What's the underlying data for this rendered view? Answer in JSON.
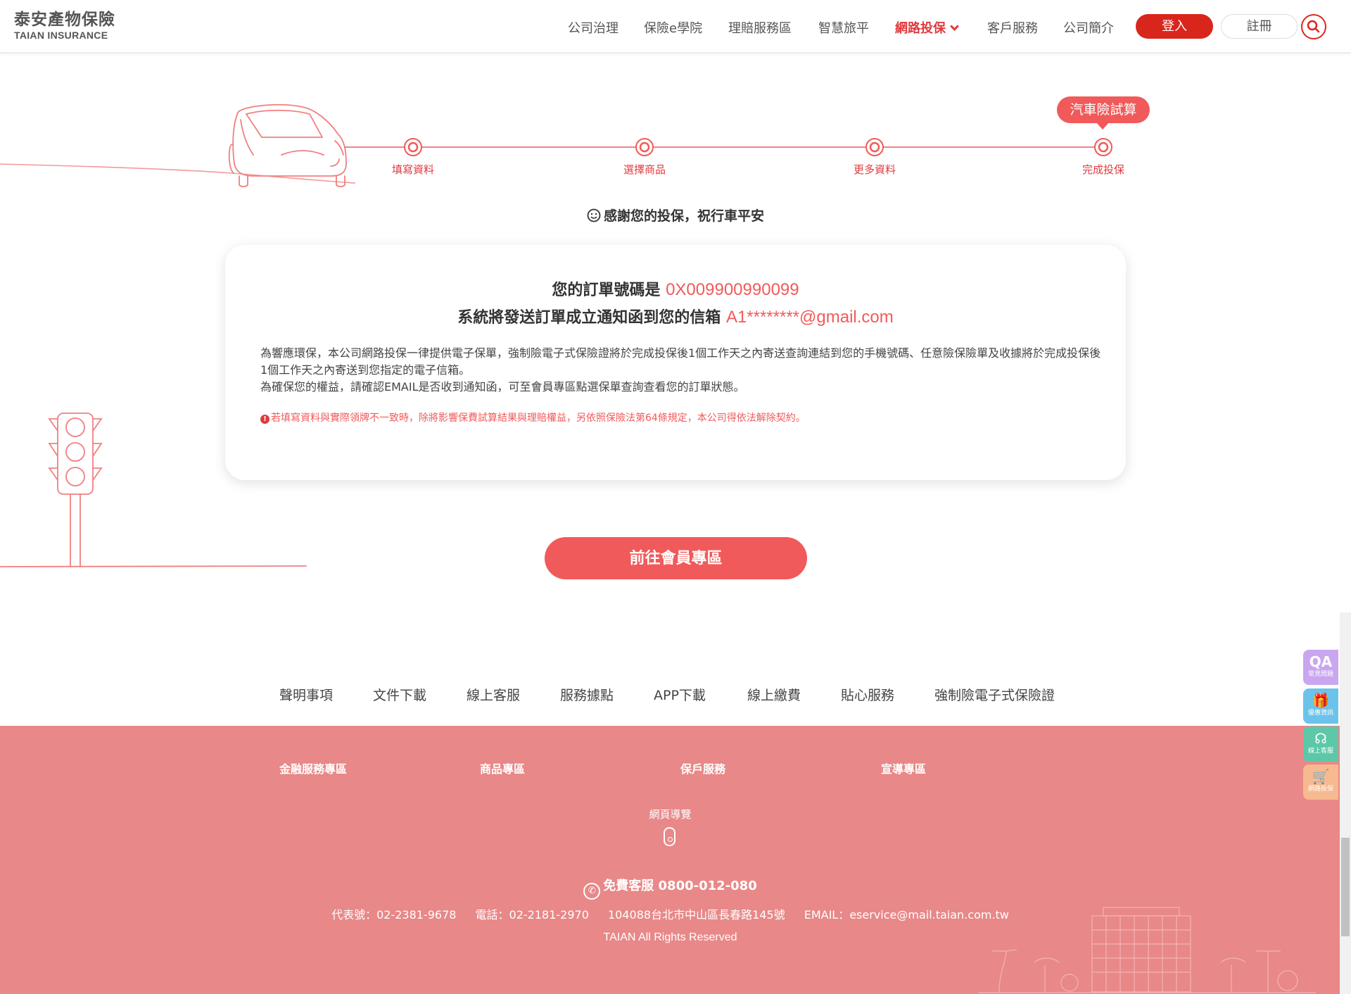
{
  "header": {
    "logo_cn": "泰安產物保險",
    "logo_en": "TAIAN INSURANCE",
    "nav": [
      {
        "label": "公司治理"
      },
      {
        "label": "保險e學院"
      },
      {
        "label": "理賠服務區"
      },
      {
        "label": "智慧旅平"
      },
      {
        "label": "網路投保"
      },
      {
        "label": "客戶服務"
      },
      {
        "label": "公司簡介"
      }
    ],
    "login_label": "登入",
    "register_label": "註冊",
    "accent_color": "#d9261c"
  },
  "steps": {
    "tag": "汽車險試算",
    "items": [
      "填寫資料",
      "選擇商品",
      "更多資料",
      "完成投保"
    ],
    "current": 4
  },
  "thanks": "感謝您的投保，祝行車平安",
  "card": {
    "order_prefix": "您的訂單號碼是",
    "order_number": "0X009900990099",
    "email_prefix": "系統將發送訂單成立通知函到您的信箱",
    "email": "A1********@gmail.com",
    "para1": "為響應環保，本公司網路投保一律提供電子保單，強制險電子式保險證將於完成投保後1個工作天之內寄送查詢連結到您的手機號碼、任意險保險單及收據將於完成投保後1個工作天之內寄送到您指定的電子信箱。",
    "para2": "為確保您的權益，請確認EMAIL是否收到通知函，可至會員專區點選保單查詢查看您的訂單狀態。",
    "warning": "若填寫資料與實際領牌不一致時，除將影響保費試算結果與理賠權益，另依照保險法第64條規定，本公司得依法解除契約。"
  },
  "member_button": "前往會員專區",
  "footer_links": [
    "聲明事項",
    "文件下載",
    "線上客服",
    "服務據點",
    "APP下載",
    "線上繳費",
    "貼心服務",
    "強制險電子式保險證"
  ],
  "footer": {
    "columns": [
      "金融服務專區",
      "商品專區",
      "保戶服務",
      "宣導專區"
    ],
    "sitemap": "網頁導覽",
    "hotline": "免費客服 0800-012-080",
    "contact": [
      "代表號：02-2381-9678",
      "電話：02-2181-2970",
      "104088台北市中山區長春路145號",
      "EMAIL：eservice@mail.taian.com.tw"
    ],
    "rights": "TAIAN All Rights Reserved",
    "bg_color": "#e88888"
  },
  "side_widgets": [
    {
      "icon": "QA",
      "label": "常見問題",
      "color": "#c9a6f0"
    },
    {
      "icon": "🎁",
      "label": "優惠資訊",
      "color": "#6cc3ea"
    },
    {
      "icon": "☊",
      "label": "線上客服",
      "color": "#5cc8a8"
    },
    {
      "icon": "🛒",
      "label": "網路投保",
      "color": "#f7b98f"
    }
  ]
}
